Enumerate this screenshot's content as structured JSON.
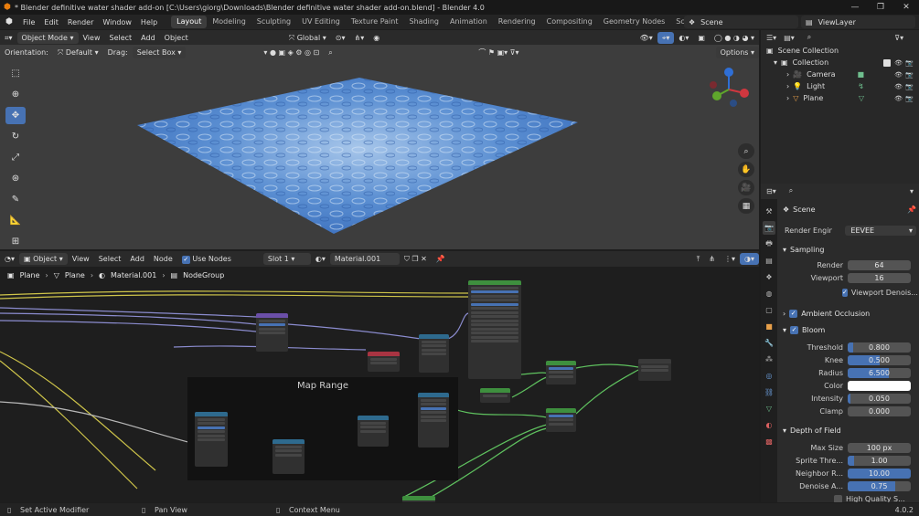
{
  "window": {
    "title": "* Blender definitive water shader add-on [C:\\Users\\giorg\\Downloads\\Blender definitive water shader add-on.blend] - Blender 4.0"
  },
  "menu": [
    "File",
    "Edit",
    "Render",
    "Window",
    "Help"
  ],
  "workspaces": [
    "Layout",
    "Modeling",
    "Sculpting",
    "UV Editing",
    "Texture Paint",
    "Shading",
    "Animation",
    "Rendering",
    "Compositing",
    "Geometry Nodes",
    "Scripting"
  ],
  "active_workspace": "Layout",
  "scene": {
    "name": "Scene",
    "view_layer": "ViewLayer"
  },
  "viewport": {
    "mode": "Object Mode",
    "menus": [
      "View",
      "Select",
      "Add",
      "Object"
    ],
    "transform_orientation": "Global",
    "orientation_label": "Orientation:",
    "orientation_value": "Default",
    "drag_label": "Drag:",
    "drag_value": "Select Box",
    "options": "Options"
  },
  "node_editor": {
    "editor_type": "Object",
    "menus": [
      "View",
      "Select",
      "Add",
      "Node"
    ],
    "use_nodes_label": "Use Nodes",
    "slot": "Slot 1",
    "material": "Material.001",
    "breadcrumb": [
      "Plane",
      "Plane",
      "Material.001",
      "NodeGroup"
    ],
    "frame_label": "Map Range"
  },
  "outliner": {
    "root": "Scene Collection",
    "collection": "Collection",
    "items": [
      "Camera",
      "Light",
      "Plane"
    ]
  },
  "properties": {
    "context": "Scene",
    "render_engine_label": "Render Engine",
    "render_engine": "EEVEE",
    "sampling": {
      "title": "Sampling",
      "render_label": "Render",
      "render": "64",
      "viewport_label": "Viewport",
      "viewport": "16",
      "denoise_label": "Viewport Denois..."
    },
    "ambient_occlusion": "Ambient Occlusion",
    "bloom": {
      "title": "Bloom",
      "threshold_label": "Threshold",
      "threshold": "0.800",
      "threshold_level": 0.08,
      "knee_label": "Knee",
      "knee": "0.500",
      "knee_level": 0.5,
      "radius_label": "Radius",
      "radius": "6.500",
      "radius_level": 0.65,
      "color_label": "Color",
      "color": "#ffffff",
      "intensity_label": "Intensity",
      "intensity": "0.050",
      "intensity_level": 0.05,
      "clamp_label": "Clamp",
      "clamp": "0.000"
    },
    "depth_of_field": {
      "title": "Depth of Field",
      "max_size_label": "Max Size",
      "max_size": "100 px",
      "sprite_label": "Sprite Thre...",
      "sprite": "1.00",
      "sprite_level": 0.1,
      "neighbor_label": "Neighbor R...",
      "neighbor": "10.00",
      "neighbor_level": 1.0,
      "denoise_label": "Denoise A...",
      "denoise": "0.75",
      "denoise_level": 0.75,
      "hq_label": "High Quality S..."
    }
  },
  "status": {
    "left": "Set Active Modifier",
    "middle": "Pan View",
    "right": "Context Menu",
    "version": "4.0.2"
  },
  "colors": {
    "accent": "#4772b3",
    "brand": "#e87d0d"
  }
}
